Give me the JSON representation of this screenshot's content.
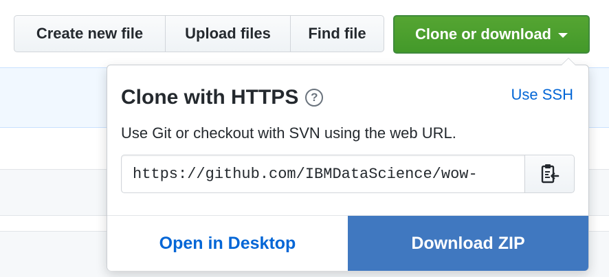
{
  "toolbar": {
    "create_new_file": "Create new file",
    "upload_files": "Upload files",
    "find_file": "Find file",
    "clone_or_download": "Clone or download"
  },
  "clone_panel": {
    "title": "Clone with HTTPS",
    "help_symbol": "?",
    "use_ssh": "Use SSH",
    "description": "Use Git or checkout with SVN using the web URL.",
    "url_value": "https://github.com/IBMDataScience/wow-",
    "copy_icon": "clipboard-icon",
    "open_in_desktop": "Open in Desktop",
    "download_zip": "Download ZIP"
  },
  "colors": {
    "clone_button_green": "#55a532",
    "download_zip_blue": "#4078c0",
    "link_blue": "#0366d6"
  }
}
